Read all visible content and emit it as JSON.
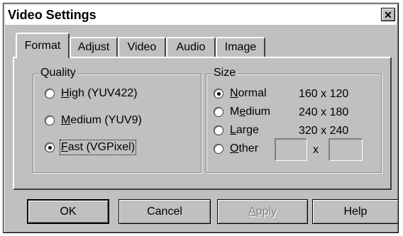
{
  "window": {
    "title": "Video Settings",
    "close_label": "✕"
  },
  "tabs": [
    {
      "label": "Format",
      "active": true
    },
    {
      "label": "Adjust"
    },
    {
      "label": "Video"
    },
    {
      "label": "Audio"
    },
    {
      "label": "Image"
    }
  ],
  "quality": {
    "legend": "Quality",
    "options": [
      {
        "label": "High (YUV422)",
        "accel": "H",
        "rest": "igh (YUV422)",
        "selected": false
      },
      {
        "label": "Medium (YUV9)",
        "accel": "M",
        "rest": "edium (YUV9)",
        "selected": false
      },
      {
        "label": "Fast (VGPixel)",
        "accel": "F",
        "rest": "ast (VGPixel)",
        "selected": true
      }
    ]
  },
  "size": {
    "legend": "Size",
    "options": [
      {
        "label": "Normal",
        "accel": "N",
        "rest": "ormal",
        "value": "160 x 120",
        "selected": true
      },
      {
        "label": "Medium",
        "accel": "e",
        "pre": "M",
        "rest": "dium",
        "value": "240 x 180",
        "selected": false
      },
      {
        "label": "Large",
        "accel": "L",
        "rest": "arge",
        "value": "320 x 240",
        "selected": false
      },
      {
        "label": "Other",
        "accel": "O",
        "rest": "ther",
        "selected": false
      }
    ],
    "other_separator": "x",
    "other_width": "",
    "other_height": ""
  },
  "buttons": {
    "ok": "OK",
    "cancel": "Cancel",
    "apply": "Apply",
    "apply_accel": "A",
    "apply_rest": "pply",
    "help": "Help"
  }
}
